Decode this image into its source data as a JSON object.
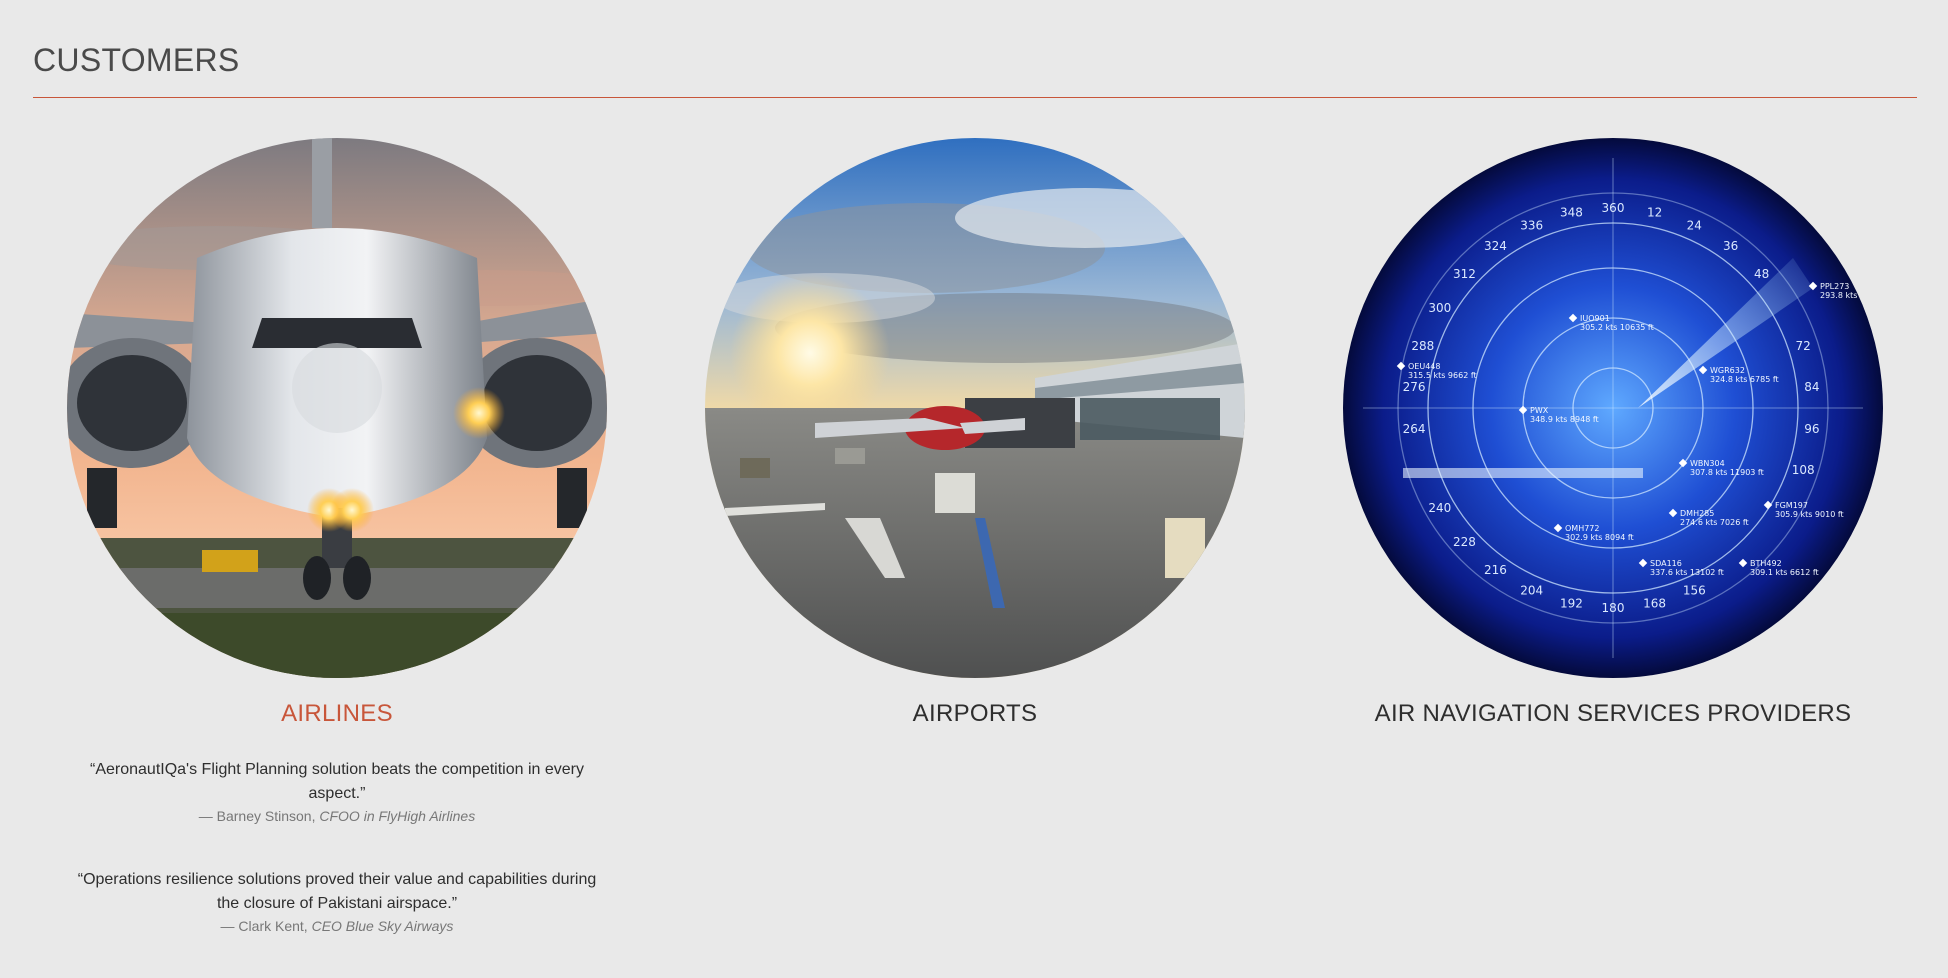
{
  "section": {
    "title": "CUSTOMERS"
  },
  "colors": {
    "accent": "#c8563a",
    "background": "#e9e9e9"
  },
  "cards": [
    {
      "label": "AIRLINES",
      "image": "airliner-front-at-sunset",
      "active": true,
      "quotes": [
        {
          "text": "“AeronautIQa's Flight Planning solution beats the competition in every aspect.”",
          "author": "— Barney Stinson,",
          "role": "CFOO in FlyHigh Airlines"
        },
        {
          "text": "“Operations resilience solutions proved their value and capabilities during the closure of Pakistani airspace.”",
          "author": "— Clark Kent,",
          "role": "CEO Blue Sky Airways"
        }
      ]
    },
    {
      "label": "AIRPORTS",
      "image": "airport-apron-with-jetbridge",
      "active": false
    },
    {
      "label": "AIR NAVIGATION SERVICES PROVIDERS",
      "image": "radar-scope",
      "active": false
    }
  ],
  "radar": {
    "bearings": [
      "360",
      "12",
      "24",
      "36",
      "48",
      "72",
      "84",
      "96",
      "108",
      "156",
      "168",
      "180",
      "192",
      "204",
      "216",
      "228",
      "240",
      "264",
      "276",
      "288",
      "300",
      "312",
      "324",
      "336",
      "348"
    ],
    "targets": [
      {
        "id": "PPL273",
        "info": "293.8 kts"
      },
      {
        "id": "IUO901",
        "info": "305.2 kts 10635 ft"
      },
      {
        "id": "OEU448",
        "info": "315.5 kts 9662 ft"
      },
      {
        "id": "WGR632",
        "info": "324.8 kts 6785 ft"
      },
      {
        "id": "PWX",
        "info": "348.9 kts 8948 ft"
      },
      {
        "id": "WBN304",
        "info": "307.8 kts 11903 ft"
      },
      {
        "id": "FGM197",
        "info": "305.9 kts 9010 ft"
      },
      {
        "id": "DMH285",
        "info": "274.6 kts 7026 ft"
      },
      {
        "id": "OMH772",
        "info": "302.9 kts 8094 ft"
      },
      {
        "id": "SDA116",
        "info": "337.6 kts 13102 ft"
      },
      {
        "id": "BTH492",
        "info": "309.1 kts 6612 ft"
      }
    ]
  }
}
